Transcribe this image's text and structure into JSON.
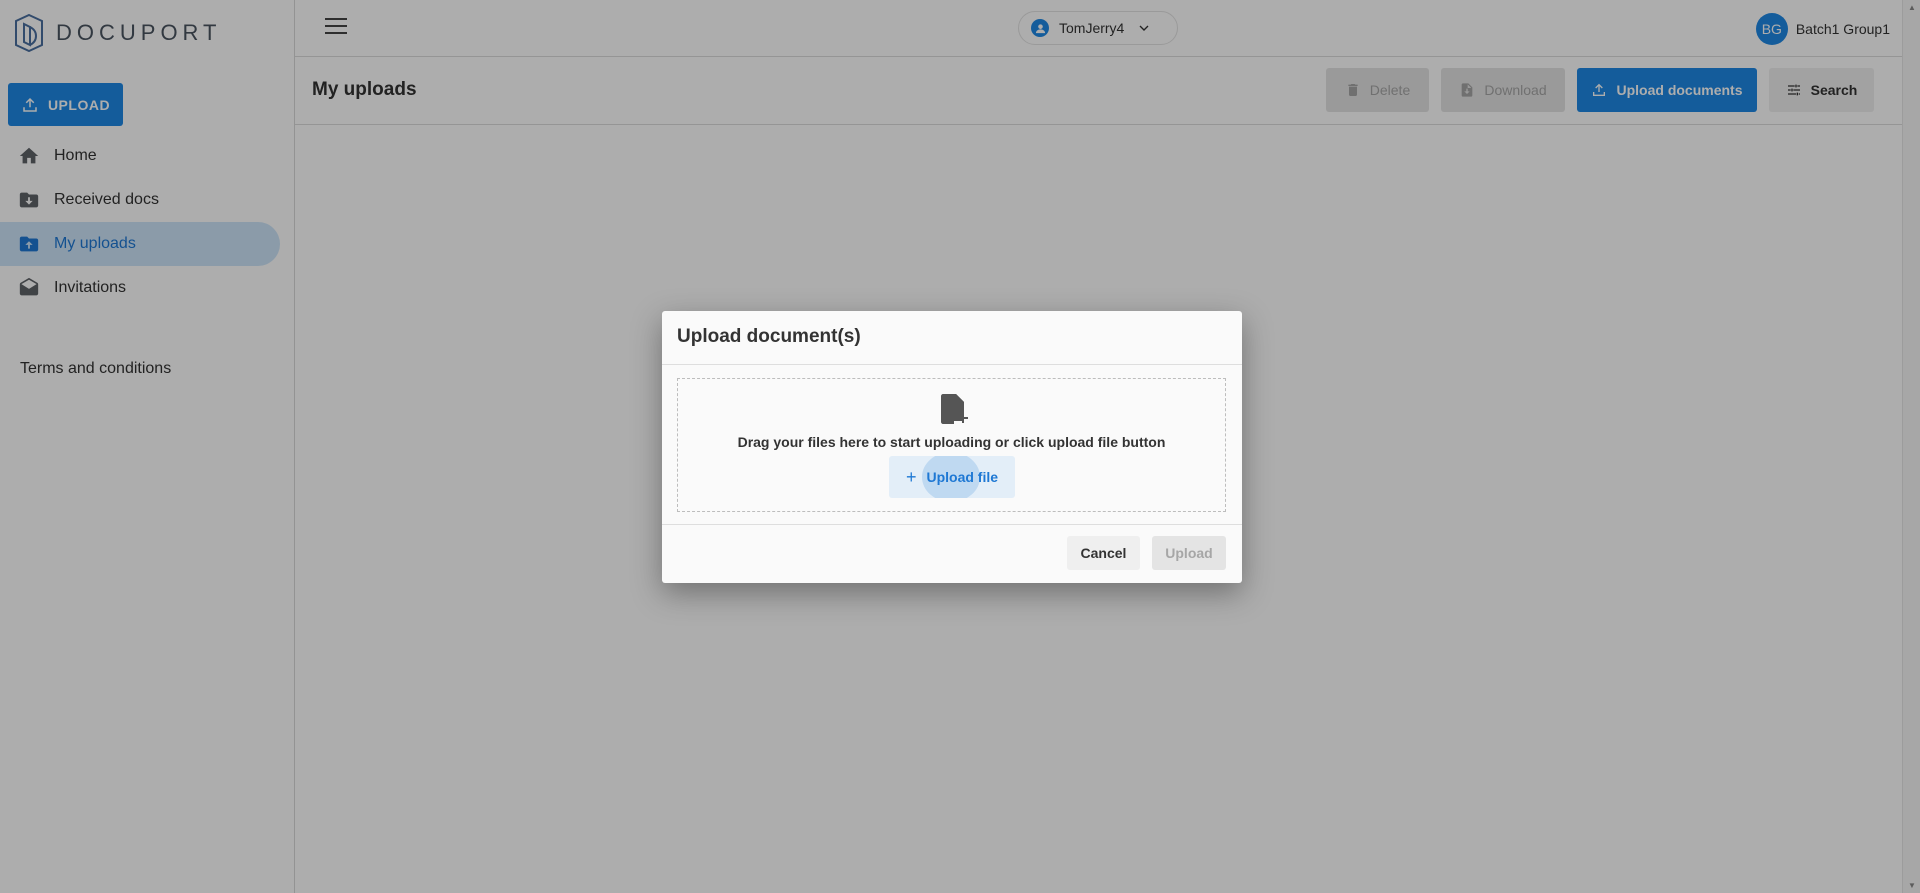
{
  "brand": {
    "name": "DOCUPORT"
  },
  "sidebar": {
    "upload_label": "UPLOAD",
    "items": [
      {
        "label": "Home",
        "icon": "home-icon"
      },
      {
        "label": "Received docs",
        "icon": "folder-download-icon"
      },
      {
        "label": "My uploads",
        "icon": "folder-upload-icon",
        "active": true
      },
      {
        "label": "Invitations",
        "icon": "envelope-open-icon"
      }
    ],
    "terms_label": "Terms and conditions"
  },
  "topbar": {
    "current_user": "TomJerry4",
    "account_initials": "BG",
    "account_name": "Batch1 Group1"
  },
  "subheader": {
    "title": "My uploads",
    "actions": {
      "delete": "Delete",
      "download": "Download",
      "upload_documents": "Upload documents",
      "search": "Search"
    }
  },
  "dialog": {
    "title": "Upload document(s)",
    "drop_text": "Drag your files here to start uploading or click upload file button",
    "upload_file_label": "Upload file",
    "cancel_label": "Cancel",
    "upload_label": "Upload"
  },
  "colors": {
    "accent": "#1e88e5",
    "active_nav_bg": "#cde5fa",
    "overlay": "rgba(0,0,0,0.32)"
  }
}
